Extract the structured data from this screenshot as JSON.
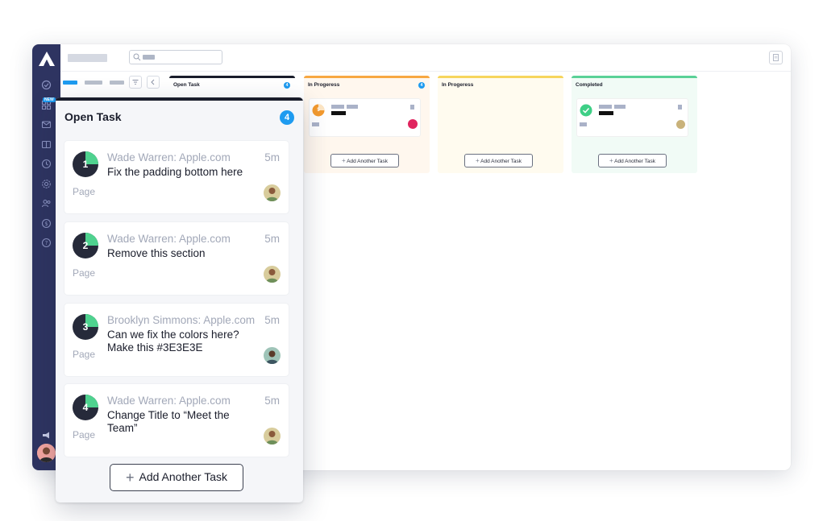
{
  "app": {
    "new_badge": "NEW"
  },
  "board": {
    "columns": [
      {
        "title": "Open Task",
        "count": "4",
        "accent": "#1a1d2b"
      },
      {
        "title": "In Progeress",
        "count": "4",
        "accent": "#f7a843",
        "add_label": "Add Another Task"
      },
      {
        "title": "In Progeress",
        "accent": "#f6d55c",
        "add_label": "Add Another Task"
      },
      {
        "title": "Completed",
        "accent": "#5ad197",
        "add_label": "Add Another Task"
      }
    ],
    "mini_badges": [
      "5"
    ]
  },
  "panel": {
    "title": "Open Task",
    "count": "4",
    "add_label": "Add Another Task",
    "tasks": [
      {
        "number": "1",
        "author": "Wade Warren: Apple.com",
        "time": "5m",
        "text": "Fix the padding bottom here",
        "page": "Page"
      },
      {
        "number": "2",
        "author": "Wade Warren: Apple.com",
        "time": "5m",
        "text": "Remove this section",
        "page": "Page"
      },
      {
        "number": "3",
        "author": "Brooklyn Simmons: Apple.com",
        "time": "5m",
        "text": "Can we fix the colors here? Make this #3E3E3E",
        "page": "Page"
      },
      {
        "number": "4",
        "author": "Wade Warren: Apple.com",
        "time": "5m",
        "text": "Change Title to “Meet the Team”",
        "page": "Page"
      }
    ]
  },
  "icons": {
    "sidebar": [
      "check-circle-icon",
      "grid-icon",
      "mail-icon",
      "book-icon",
      "clock-icon",
      "gear-icon",
      "users-icon",
      "dollar-icon",
      "help-icon",
      "megaphone-icon"
    ],
    "accent": "#1e9bf0",
    "sidebar_bg": "#2e3461"
  }
}
